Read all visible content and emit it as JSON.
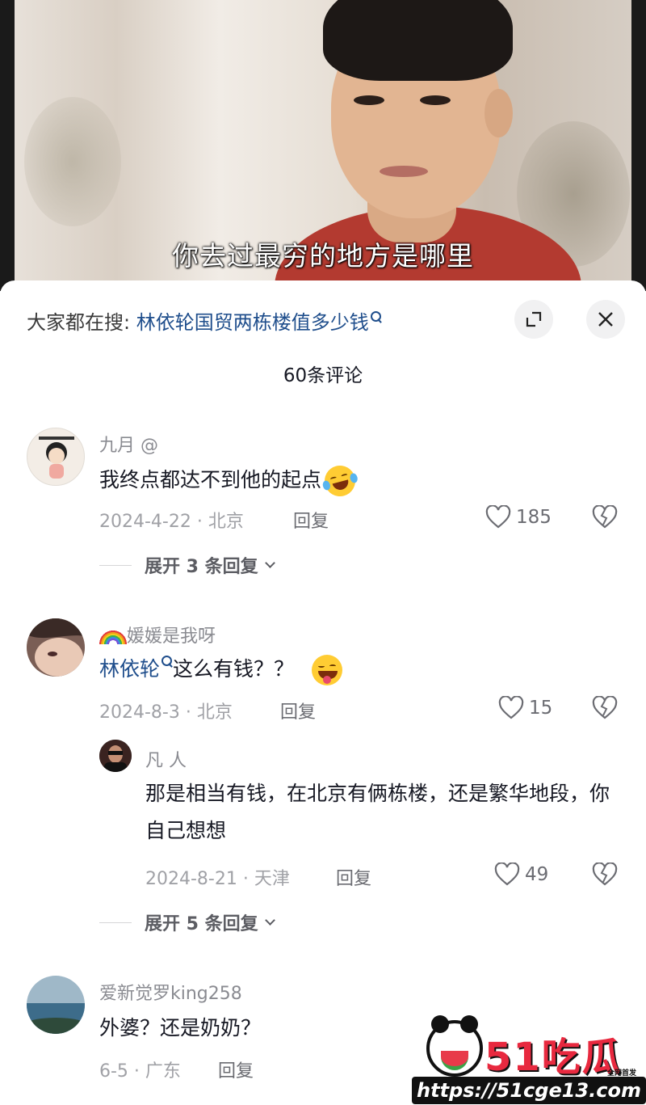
{
  "video": {
    "subtitle": "你去过最穷的地方是哪里"
  },
  "search": {
    "label": "大家都在搜:",
    "query": "林依轮国贸两栋楼值多少钱"
  },
  "comment_count": "60条评论",
  "comments": [
    {
      "username": "九月 @",
      "text": "我终点都达不到他的起点",
      "emoji": "laughing-crying-face-emoji",
      "date_location": "2024-4-22 · 北京",
      "reply_label": "回复",
      "likes": "185",
      "expand_replies": "展开 3 条回复"
    },
    {
      "username_prefix_icon": "rainbow-icon",
      "username": "媛媛是我呀",
      "mention": "林依轮",
      "text": "这么有钱？？",
      "emoji": "winking-tongue-face-emoji",
      "date_location": "2024-8-3 · 北京",
      "reply_label": "回复",
      "likes": "15",
      "reply": {
        "username": "凡  人",
        "text": "那是相当有钱，在北京有俩栋楼，还是繁华地段，你自己想想",
        "date_location": "2024-8-21 · 天津",
        "reply_label": "回复",
        "likes": "49"
      },
      "expand_replies": "展开 5 条回复"
    },
    {
      "username": "爱新觉罗king258",
      "text": "外婆？还是奶奶？",
      "date_location": "6-5 · 广东",
      "reply_label": "回复"
    }
  ],
  "watermark": {
    "title": "吃瓜",
    "prefix": "51",
    "badge": "全网首发",
    "url": "https://51cge13.com"
  },
  "colors": {
    "mention": "#1f4e8c",
    "secondary_text": "#8a8b91",
    "watermark_red": "#e8293f"
  }
}
